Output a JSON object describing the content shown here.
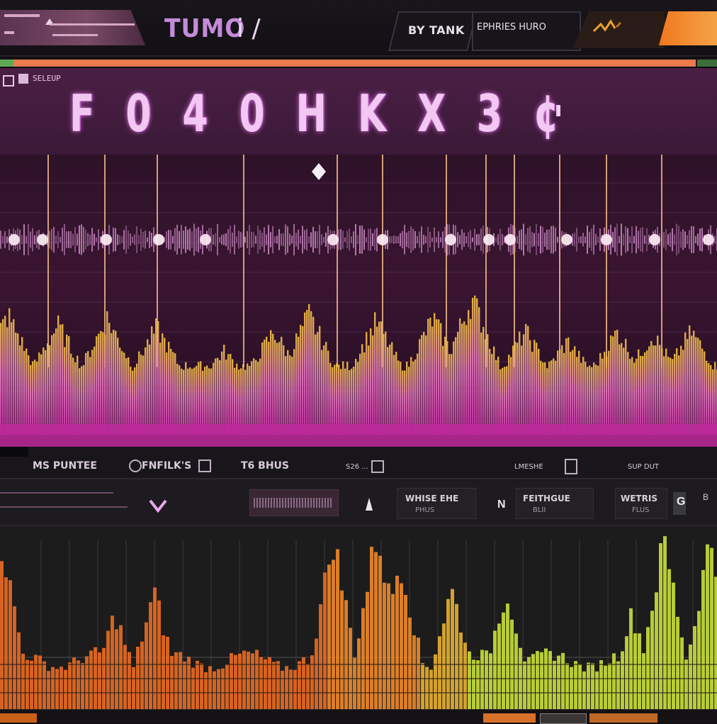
{
  "app": {
    "title": "TUMO",
    "title_suffix": "i /"
  },
  "topbar": {
    "by_label": "BY TANK",
    "preset_label": "EPHRIES HURO"
  },
  "header": {
    "small_label": "SELEUP",
    "track_title": "F 0 4 0 H K X 3 ¢"
  },
  "progress": {
    "fraction": 0.97
  },
  "wave_footer": {
    "item1": "MS PUNTEE",
    "item2": "FNFILK'S",
    "item3": "T6 BHUS",
    "item4": "S26 ...",
    "item5": "LMESHE",
    "item6": "SUP DUT"
  },
  "controls": {
    "btn1_title": "WHISE EHE",
    "btn1_sub": "PHUS",
    "n_label": "N",
    "btn2_title": "FEITHGUE",
    "btn2_sub": "BLII",
    "btn3_title": "WETRIS",
    "btn3_sub": "FLUS",
    "g_label": "G",
    "b_label": "B"
  },
  "colors": {
    "accent": "#f0781e",
    "waveform_magenta": "#d43fb2",
    "waveform_yellow": "#f2c240",
    "spectrum_orange": "#f07a25",
    "spectrum_lime": "#c9e03a"
  },
  "icons": {
    "chevron": "chevron-down-icon",
    "wave": "wave-mini-icon",
    "arrow": "arrow-up-icon"
  }
}
